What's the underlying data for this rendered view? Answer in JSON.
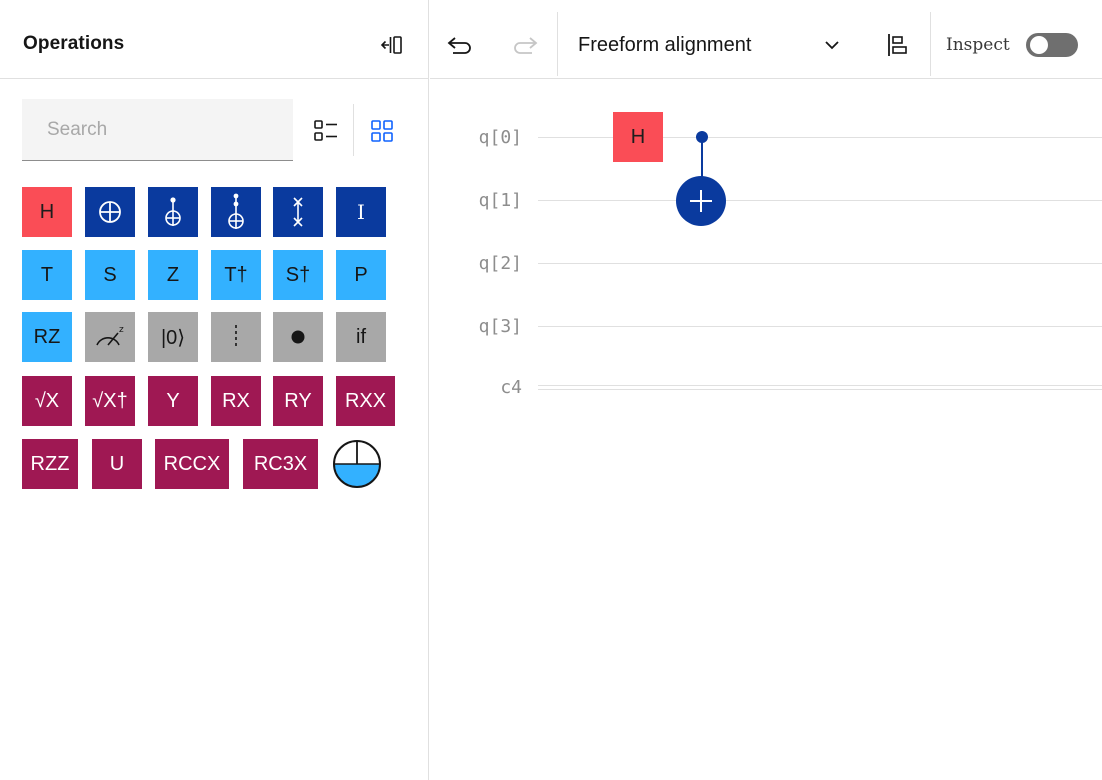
{
  "operations_panel": {
    "title": "Operations",
    "search": {
      "placeholder": "Search",
      "value": ""
    }
  },
  "gates": {
    "row1": [
      "H",
      "",
      "",
      "",
      "",
      "I"
    ],
    "row2": [
      "T",
      "S",
      "Z",
      "T†",
      "S†",
      "P"
    ],
    "row3": [
      "RZ",
      "",
      "|0⟩",
      "",
      "",
      "if"
    ],
    "row4": [
      "√X",
      "√X†",
      "Y",
      "RX",
      "RY",
      "RXX"
    ],
    "row5": [
      "RZZ",
      "U",
      "RCCX",
      "RC3X",
      ""
    ],
    "icon_gates": {
      "cnot": "cnot-icon",
      "ccx": "toffoli-icon",
      "c3x": "c3x-icon",
      "swap": "swap-icon",
      "measure": "measure-icon",
      "barrier": "barrier-icon",
      "control": "control-dot-icon",
      "probability": "probability-disk-icon"
    }
  },
  "toolbar": {
    "alignment": "Freeform alignment",
    "inspect_label": "Inspect",
    "inspect_on": false
  },
  "circuit": {
    "wires": [
      "q[0]",
      "q[1]",
      "q[2]",
      "q[3]"
    ],
    "classical": "c4",
    "gates": [
      {
        "label": "H",
        "wire": "q[0]"
      },
      {
        "label": "",
        "type": "CNOT",
        "control": "q[0]",
        "target": "q[1]"
      }
    ]
  },
  "colors": {
    "h_gate": "#fa4d56",
    "navy_gate": "#0a3a9e",
    "phase_gate": "#33b1ff",
    "gray_gate": "#a8a8a8",
    "rotation_gate": "#9f1853"
  }
}
